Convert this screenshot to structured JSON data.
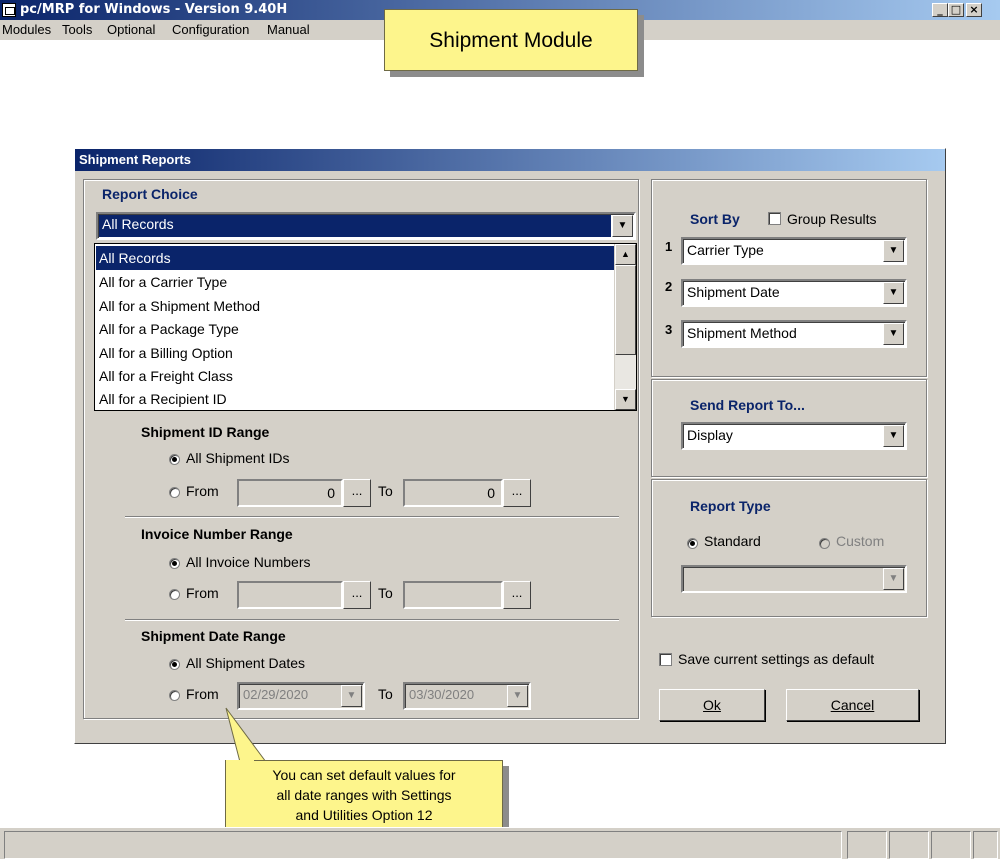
{
  "window": {
    "title": "pc/MRP for Windows - Version 9.40H",
    "controls": [
      "_",
      "□",
      "×"
    ]
  },
  "menu": [
    "Modules",
    "Tools",
    "Optional",
    "Configuration",
    "Manual"
  ],
  "callouts": {
    "module": "Shipment Module",
    "tip_line1": "You can set default values for",
    "tip_line2": "all date ranges with Settings",
    "tip_line3": "and Utilities Option 12"
  },
  "dialog": {
    "title": "Shipment Reports",
    "report_choice": {
      "label": "Report Choice",
      "value": "All Records",
      "options": [
        "All Records",
        "All for a Carrier Type",
        "All for a Shipment Method",
        "All for a Package Type",
        "All for a Billing Option",
        "All for a Freight Class",
        "All for a Recipient ID"
      ]
    },
    "shipment_id_range": {
      "label": "Shipment ID Range",
      "all_label": "All Shipment IDs",
      "from_label": "From",
      "to_label": "To",
      "from_value": "0",
      "to_value": "0",
      "lookup": "..."
    },
    "invoice_range": {
      "label": "Invoice Number Range",
      "all_label": "All Invoice Numbers",
      "from_label": "From",
      "to_label": "To",
      "lookup": "..."
    },
    "date_range": {
      "label": "Shipment Date Range",
      "all_label": "All Shipment Dates",
      "from_label": "From",
      "to_label": "To",
      "from_value": "02/29/2020",
      "to_value": "03/30/2020"
    },
    "sort": {
      "label": "Sort By",
      "group_results": "Group Results",
      "rows": [
        {
          "num": "1",
          "value": "Carrier Type"
        },
        {
          "num": "2",
          "value": "Shipment Date"
        },
        {
          "num": "3",
          "value": "Shipment Method"
        }
      ]
    },
    "send_to": {
      "label": "Send Report To...",
      "value": "Display"
    },
    "report_type": {
      "label": "Report Type",
      "standard": "Standard",
      "custom": "Custom"
    },
    "save_default": "Save current settings as default",
    "ok": "Ok",
    "cancel": "Cancel"
  }
}
